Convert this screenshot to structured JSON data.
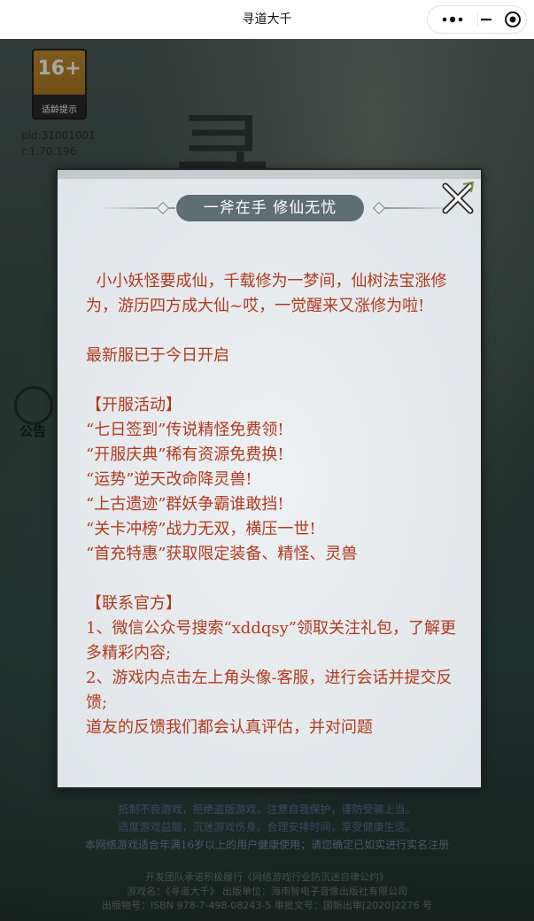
{
  "app": {
    "title": "寻道大千"
  },
  "capsule": {
    "more_icon": "more-dots-icon",
    "minimize_icon": "minimize-icon",
    "close_icon": "target-close-icon"
  },
  "background": {
    "age_rating": "16+",
    "age_tip": "适龄提示",
    "pid": "pid:31001001",
    "version": "r:1.70.196",
    "notice_label": "公告",
    "warnings": [
      "抵制不良游戏，拒绝盗版游戏。注意自我保护，谨防受骗上当。",
      "适度游戏益脑，沉迷游戏伤身。合理安排时间，享受健康生活。",
      "本网络游戏适合年满16岁以上的用户健康使用；请您确定已如实进行实名注册"
    ],
    "info_lines": [
      "开发团队承诺积极履行《网络游戏行业防沉迷自律公约》",
      "游戏名：《寻道大千》 出版单位：海南智电子音像出版社有限公司",
      "出版物号：ISBN 978-7-498-08243-5  审批文号：国新出审[2020]2276 号"
    ]
  },
  "modal": {
    "banner_title": "一斧在手 修仙无忧",
    "close_icon": "close-x-icon",
    "paragraphs": [
      "  小小妖怪要成仙，千载修为一梦间，仙树法宝涨修为，游历四方成大仙~哎，一觉醒来又涨修为啦!",
      "",
      "最新服已于今日开启",
      "",
      "【开服活动】",
      "“七日签到”传说精怪免费领!",
      "“开服庆典”稀有资源免费换!",
      "“运势”逆天改命降灵兽!",
      "“上古遗迹”群妖争霸谁敢挡!",
      "“关卡冲榜”战力无双，横压一世!",
      "“首充特惠”获取限定装备、精怪、灵兽",
      "",
      "【联系官方】",
      "1、微信公众号搜索“xddqsy”领取关注礼包，了解更多精彩内容;",
      "2、游戏内点击左上角头像-客服，进行会话并提交反馈;",
      "道友的反馈我们都会认真评估，并对问题"
    ]
  }
}
